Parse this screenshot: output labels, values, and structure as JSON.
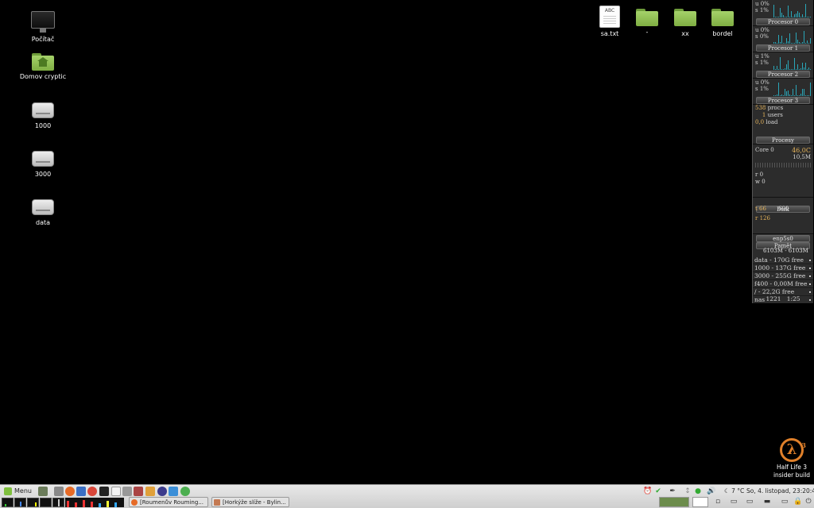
{
  "desktop": {
    "left_icons": [
      {
        "label": "Počítač",
        "icon": "computer-icon"
      },
      {
        "label": "Domov cryptic",
        "icon": "home-folder-icon"
      },
      {
        "label": "1000",
        "icon": "drive-icon"
      },
      {
        "label": "3000",
        "icon": "drive-icon"
      },
      {
        "label": "data",
        "icon": "drive-icon"
      }
    ],
    "top_icons": [
      {
        "label": "sa.txt",
        "icon": "text-file-icon",
        "badge": "ABC"
      },
      {
        "label": "-",
        "icon": "folder-icon"
      },
      {
        "label": "xx",
        "icon": "folder-icon"
      },
      {
        "label": "bordel",
        "icon": "folder-icon"
      }
    ],
    "game_shortcut": {
      "line1": "Half Life 3",
      "line2": "insider build",
      "symbol": "λ",
      "sup": "3"
    }
  },
  "conky": {
    "cpus": [
      {
        "u": "u 0%",
        "s": "s 1%",
        "title": "Procesor 0"
      },
      {
        "u": "u 0%",
        "s": "s 0%",
        "title": "Procesor 1"
      },
      {
        "u": "u 1%",
        "s": "s 1%",
        "title": "Procesor 2"
      },
      {
        "u": "u 0%",
        "s": "s 1%",
        "title": "Procesor 3"
      }
    ],
    "procs": {
      "count": "538",
      "count_label": "procs",
      "users": "1",
      "users_label": "users",
      "load": "0,0",
      "load_label": "load",
      "title": "Procesy"
    },
    "temp": {
      "label": "Core 0",
      "value": "46,0C",
      "mem": "10,5M"
    },
    "io": {
      "r": "r 0",
      "w": "w 0"
    },
    "disk": {
      "title": "Disk",
      "t": "t 66",
      "t_peak": "600",
      "r": "r 126"
    },
    "net": {
      "iface": "enp5s0",
      "title": "Pamět",
      "mem": "6103M - 6103M"
    },
    "mounts": [
      "data - 170G free",
      "1000 - 137G free",
      "3000 - 255G free",
      "f400 - 0,00M free",
      "/ - 22,2G free",
      "nas"
    ],
    "footer": "1221   1:25",
    "accent": "#2aa6b8",
    "highlight": "#e6b45b"
  },
  "taskbar": {
    "menu_label": "Menu",
    "tasks": [
      {
        "label": "[Roumenův Rouming..."
      },
      {
        "label": "[Horkýže slíže - Bylin..."
      }
    ],
    "weather": "7 °C",
    "clock": "So, 4. listopad, 23:20:42"
  }
}
